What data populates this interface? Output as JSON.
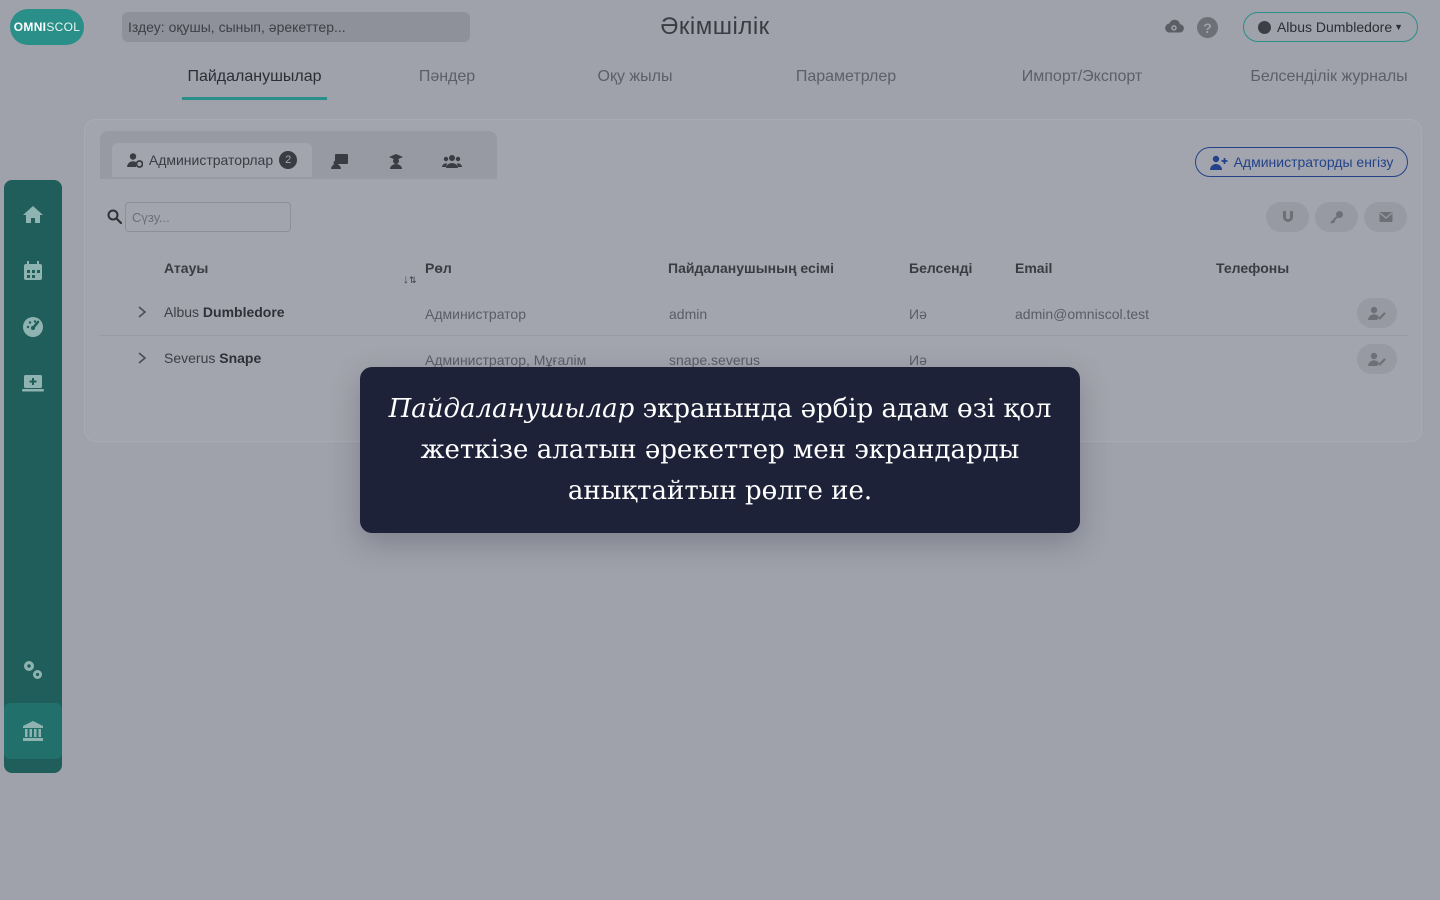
{
  "logo": {
    "bold": "OMNI",
    "light": "SCOL"
  },
  "search": {
    "placeholder": "Іздеу: оқушы, сынып, әрекеттер..."
  },
  "app_title": "Әкімшілік",
  "user": {
    "name": "Albus Dumbledore"
  },
  "help": {
    "label": "?"
  },
  "main_tabs": [
    {
      "label": "Пайдаланушылар",
      "active": true
    },
    {
      "label": "Пәндер"
    },
    {
      "label": "Оқу жылы"
    },
    {
      "label": "Параметрлер"
    },
    {
      "label": "Импорт/Экспорт"
    },
    {
      "label": "Белсенділік журналы"
    }
  ],
  "sidebar": {
    "items": [
      {
        "icon": "home-icon"
      },
      {
        "icon": "calendar-icon"
      },
      {
        "icon": "dashboard-icon"
      },
      {
        "icon": "computer-plus-icon"
      },
      {
        "icon": "cogs-icon"
      },
      {
        "icon": "bank-icon",
        "active": true
      }
    ]
  },
  "sub_tabs": {
    "active_label": "Администраторлар",
    "active_count": "2",
    "icons": [
      "teacher-icon",
      "student-icon",
      "users-group-icon"
    ]
  },
  "add_admin_label": "Администраторды енгізу",
  "filter": {
    "placeholder": "Сүзу..."
  },
  "actions": [
    "magnet-icon",
    "key-icon",
    "envelope-icon"
  ],
  "table": {
    "columns": [
      "Атауы",
      "Рөл",
      "Пайдаланушының есімі",
      "Белсенді",
      "Email",
      "Телефоны"
    ],
    "rows": [
      {
        "first": "Albus",
        "last": "Dumbledore",
        "role": "Администратор",
        "username": "admin",
        "active": "Иә",
        "email": "admin@omniscol.test",
        "phone": ""
      },
      {
        "first": "Severus",
        "last": "Snape",
        "role": "Администратор, Мұғалім",
        "username": "snape.severus",
        "active": "Иә",
        "email": "",
        "phone": ""
      }
    ]
  },
  "tooltip": {
    "emphasis": "Пайдаланушылар",
    "text": " экранында әрбір адам өзі қол жеткізе алатын әрекеттер мен экрандарды анықтайтын рөлге ие."
  },
  "colors": {
    "accent": "#2a8f88",
    "sidebar": "#1f5e5a",
    "link": "#23428a",
    "tooltip_bg": "#1d2238"
  }
}
